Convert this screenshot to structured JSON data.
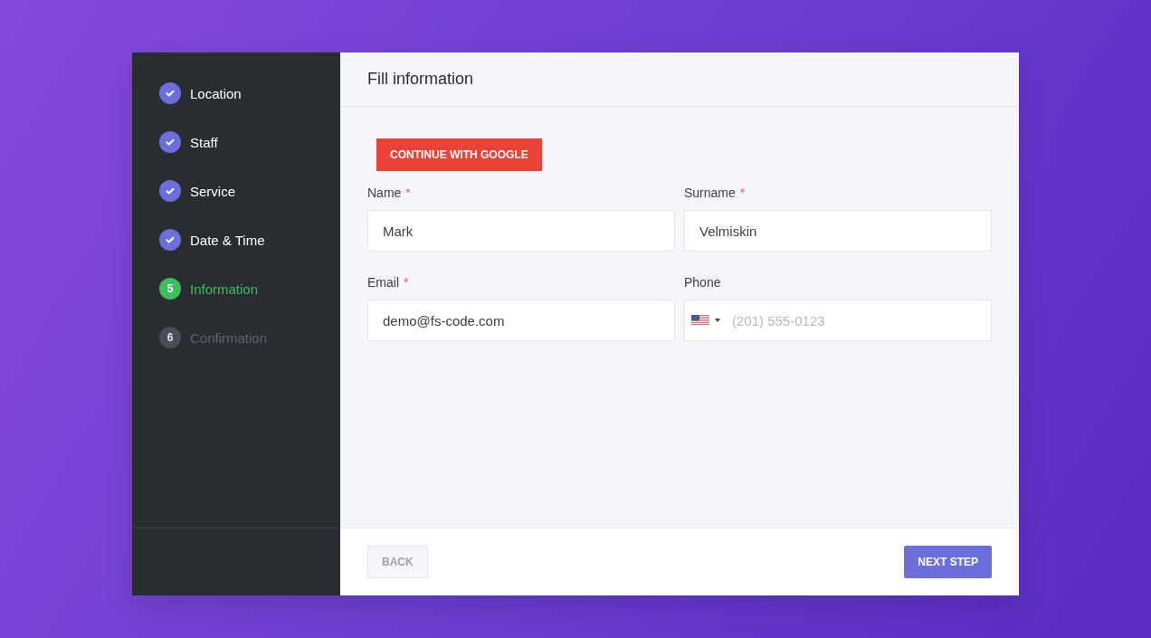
{
  "steps": [
    {
      "label": "Location",
      "done": true,
      "selected": false
    },
    {
      "label": "Staff",
      "done": true,
      "selected": false
    },
    {
      "label": "Service",
      "done": true,
      "selected": false
    },
    {
      "label": "Date & Time",
      "done": true,
      "selected": false
    },
    {
      "number": "5",
      "label": "Information",
      "done": false,
      "selected": true
    },
    {
      "number": "6",
      "label": "Confirmation",
      "done": false,
      "selected": false
    }
  ],
  "header": {
    "title": "Fill information"
  },
  "google_button": {
    "label": "CONTINUE WITH GOOGLE"
  },
  "fields": [
    {
      "kind": "text",
      "label": "Name",
      "marker": "*",
      "value": "Mark"
    },
    {
      "kind": "text",
      "label": "Surname",
      "marker": "*",
      "value": "Velmiskin"
    },
    {
      "kind": "text",
      "label": "Email",
      "marker": "*",
      "value": "demo@fs-code.com"
    },
    {
      "kind": "phone",
      "label": "Phone",
      "placeholder": "(201) 555-0123"
    }
  ],
  "footer": {
    "back": {
      "label": "BACK"
    },
    "next": {
      "label": "NEXT STEP"
    }
  }
}
